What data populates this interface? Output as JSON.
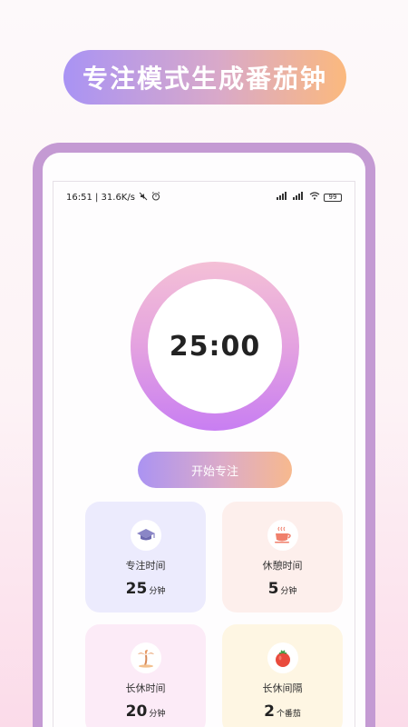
{
  "banner": {
    "title": "专注模式生成番茄钟"
  },
  "status_bar": {
    "left_text": "16:51 | 31.6K/s",
    "battery": "99"
  },
  "timer": {
    "display": "25:00",
    "progress_fraction": 1.0
  },
  "start_button": {
    "label": "开始专注"
  },
  "cards": [
    {
      "label": "专注时间",
      "value": "25",
      "unit": "分钟",
      "icon": "graduation-cap-icon",
      "color": "#ecebfd"
    },
    {
      "label": "休憩时间",
      "value": "5",
      "unit": "分钟",
      "icon": "coffee-cup-icon",
      "color": "#fdefec"
    },
    {
      "label": "长休时间",
      "value": "20",
      "unit": "分钟",
      "icon": "palm-tree-icon",
      "color": "#fcebf7"
    },
    {
      "label": "长休间隔",
      "value": "2",
      "unit": "个番茄",
      "icon": "tomato-icon",
      "color": "#fef6e3"
    }
  ],
  "colors": {
    "frame": "#c49ad3",
    "ring_top": "#f4c0d6",
    "ring_bottom": "#c87ef2"
  }
}
